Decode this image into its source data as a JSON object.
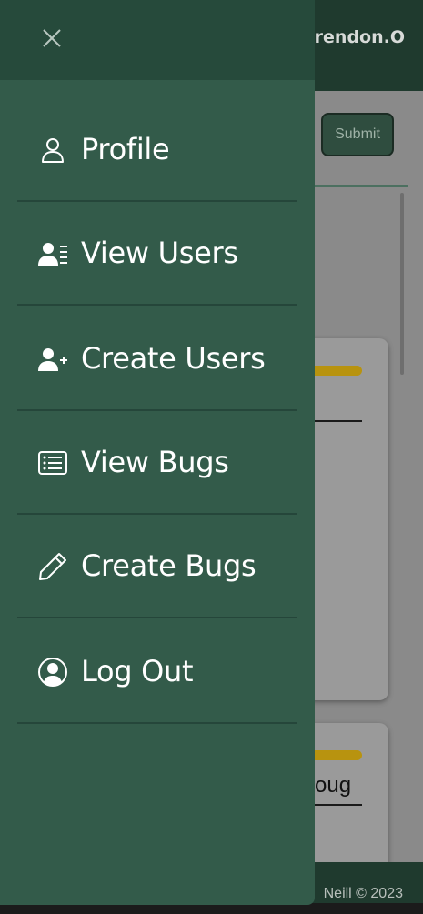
{
  "app": {
    "brand_name_partial": "rendon.O",
    "submit_label": "Submit",
    "card2_text_partial": "oug",
    "footer_text_partial": "Neill © 2023"
  },
  "drawer": {
    "close_icon": "close-icon",
    "items": [
      {
        "label": "Profile",
        "icon": "person-outline-icon"
      },
      {
        "label": "View Users",
        "icon": "users-list-icon"
      },
      {
        "label": "Create Users",
        "icon": "person-add-icon"
      },
      {
        "label": "View Bugs",
        "icon": "list-box-icon"
      },
      {
        "label": "Create Bugs",
        "icon": "pencil-icon"
      },
      {
        "label": "Log Out",
        "icon": "person-circle-icon"
      }
    ]
  },
  "colors": {
    "drawer_bg": "#335b4a",
    "drawer_header_bg": "#264a3b",
    "topbar_bg": "#1f3a2e",
    "accent_bar": "#b8930f"
  }
}
